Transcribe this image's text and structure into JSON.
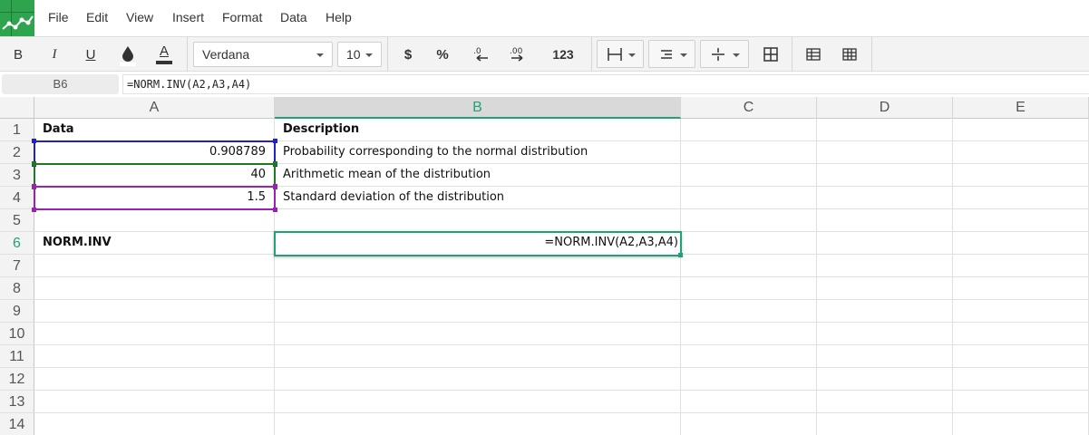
{
  "menu": [
    "File",
    "Edit",
    "View",
    "Insert",
    "Format",
    "Data",
    "Help"
  ],
  "toolbar": {
    "bold": "B",
    "italic": "I",
    "underline": "U",
    "font_color_glyph": "A",
    "font_name": "Verdana",
    "font_size": "10",
    "currency": "$",
    "percent": "%",
    "number_format": "123"
  },
  "formula_bar": {
    "cell_ref": "B6",
    "formula": "=NORM.INV(A2,A3,A4)"
  },
  "columns": [
    "A",
    "B",
    "C",
    "D",
    "E"
  ],
  "rows": [
    "1",
    "2",
    "3",
    "4",
    "5",
    "6",
    "7",
    "8",
    "9",
    "10",
    "11",
    "12",
    "13",
    "14"
  ],
  "cells": {
    "A1": "Data",
    "B1": "Description",
    "A2": "0.908789",
    "B2": "Probability corresponding to the normal distribution",
    "A3": "40",
    "B3": "Arithmetic mean of the distribution",
    "A4": "1.5",
    "B4": "Standard deviation of the distribution",
    "A6": "NORM.INV",
    "B6": "=NORM.INV(A2,A3,A4)"
  },
  "colors": {
    "accent": "#21a179",
    "ref_a2": "#1f1fd6",
    "ref_a3": "#1f7a1f",
    "ref_a4": "#9b1fb8",
    "logo": "#2ea44f"
  }
}
